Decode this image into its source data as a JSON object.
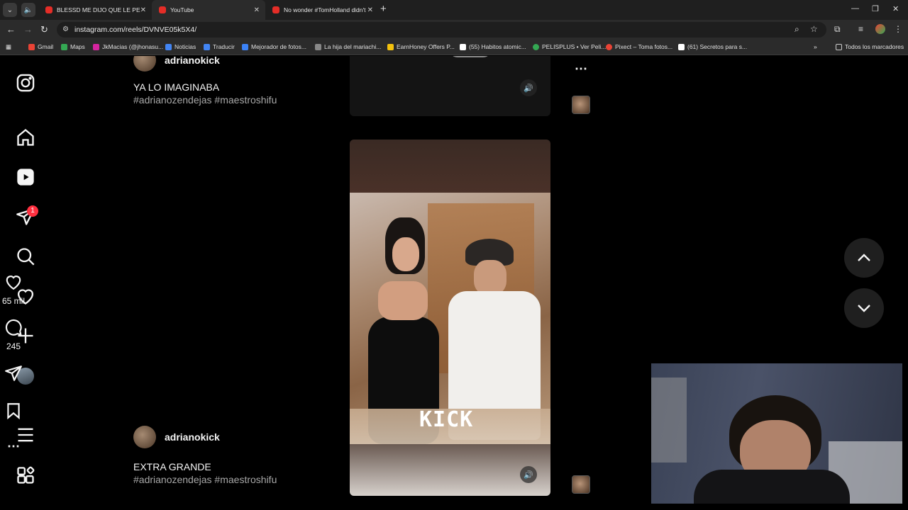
{
  "browser": {
    "tabs": [
      {
        "title": "BLESSD ME DIJO QUE LE PE",
        "active": false
      },
      {
        "title": "YouTube",
        "active": true
      },
      {
        "title": "No wonder #TomHolland didn't",
        "active": false
      }
    ],
    "url": "instagram.com/reels/DVNVE05k5X4/",
    "bookmarks": [
      {
        "label": "Gmail",
        "color": "#ea4335"
      },
      {
        "label": "Maps",
        "color": "#34a853"
      },
      {
        "label": "JkMacias (@jhonasu...",
        "color": "#d6249f"
      },
      {
        "label": "Noticias",
        "color": "#4285f4"
      },
      {
        "label": "Traducir",
        "color": "#4285f4"
      },
      {
        "label": "Mejorador de fotos...",
        "color": "#3b82f6"
      },
      {
        "label": "La hija del mariachi...",
        "color": "#888888"
      },
      {
        "label": "EarnHoney Offers P...",
        "color": "#f4c20d"
      },
      {
        "label": "(55) Habitos atomic...",
        "color": "#ffffff"
      },
      {
        "label": "PELISPLUS • Ver Peli...",
        "color": "#34a853"
      },
      {
        "label": "Pixect – Toma fotos...",
        "color": "#ea4335"
      },
      {
        "label": "(61) Secretos para s...",
        "color": "#ffffff"
      }
    ],
    "all_bookmarks": "Todos los marcadores",
    "overflow": "»"
  },
  "sidebar": {
    "icons": [
      "instagram-logo-icon",
      "home-icon",
      "reels-icon",
      "messages-icon",
      "search-icon",
      "heart-icon",
      "create-icon",
      "profile-avatar",
      "menu-icon",
      "apps-icon"
    ],
    "messages_badge": "1"
  },
  "reels": [
    {
      "username": "adrianokick",
      "caption": "YA LO IMAGINABA",
      "tags": "#adrianozendejas #maestroshifu"
    },
    {
      "username": "adrianokick",
      "caption": "EXTRA GRANDE",
      "tags": "#adrianozendejas #maestroshifu",
      "likes": "65 mil",
      "comments": "245",
      "watermark": "KICK"
    }
  ]
}
